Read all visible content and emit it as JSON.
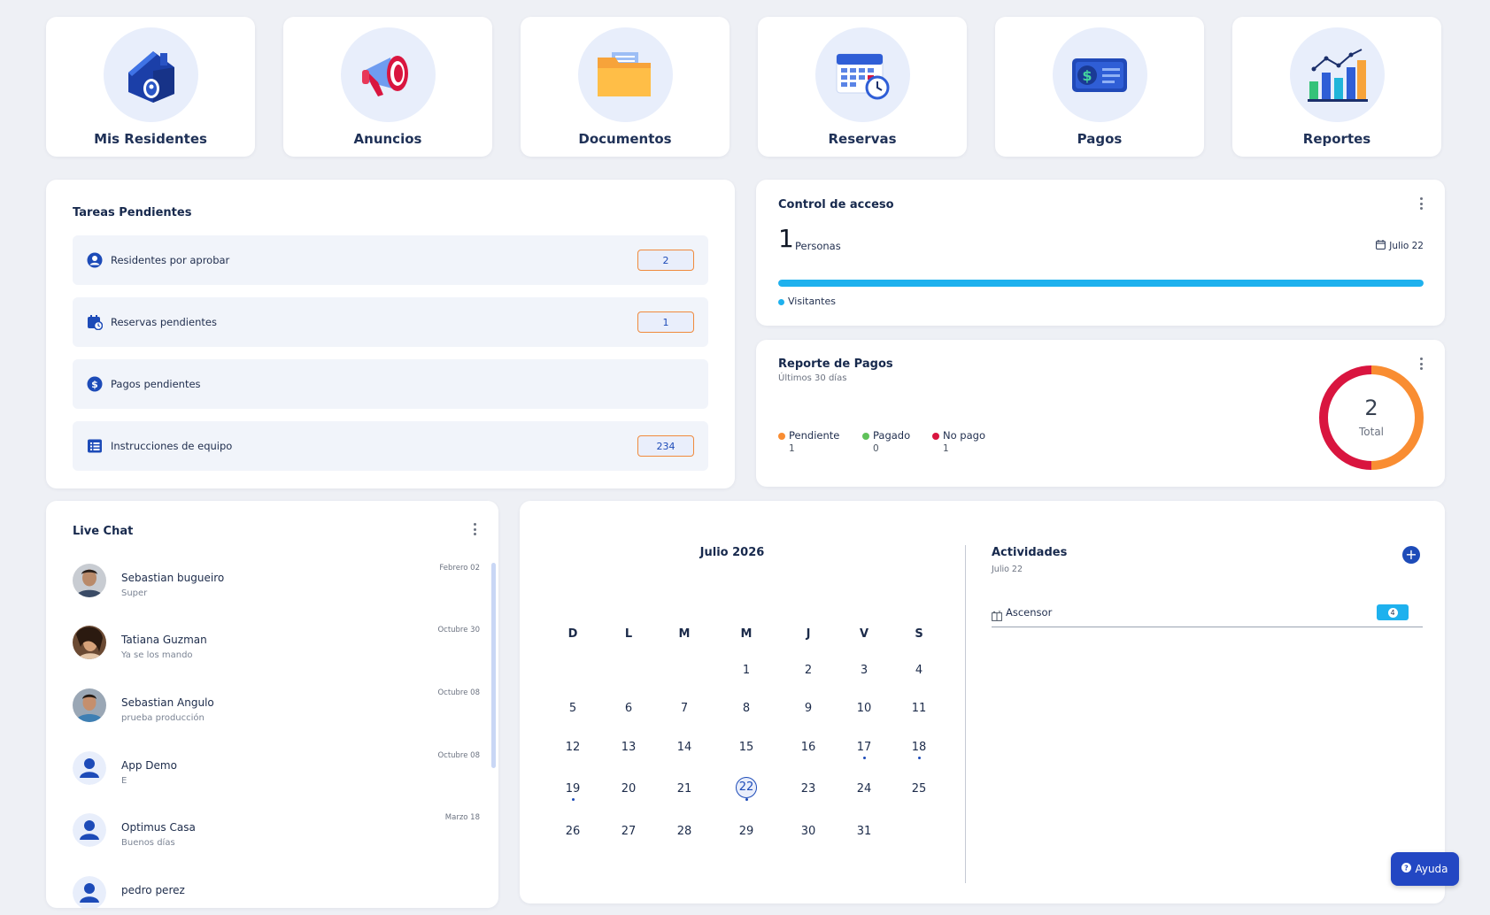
{
  "tiles": [
    {
      "label": "Mis Residentes",
      "icon": "house-icon"
    },
    {
      "label": "Anuncios",
      "icon": "megaphone-icon"
    },
    {
      "label": "Documentos",
      "icon": "folder-icon"
    },
    {
      "label": "Reservas",
      "icon": "calendar-clock-icon"
    },
    {
      "label": "Pagos",
      "icon": "money-icon"
    },
    {
      "label": "Reportes",
      "icon": "bar-chart-icon"
    }
  ],
  "tasks": {
    "title": "Tareas Pendientes",
    "items": [
      {
        "label": "Residentes por aprobar",
        "badge": "2",
        "icon": "user-circle-icon"
      },
      {
        "label": "Reservas pendientes",
        "badge": "1",
        "icon": "calendar-icon"
      },
      {
        "label": "Pagos pendientes",
        "badge": "",
        "icon": "dollar-circle-icon"
      },
      {
        "label": "Instrucciones de equipo",
        "badge": "234",
        "icon": "list-icon"
      }
    ]
  },
  "access": {
    "title": "Control de acceso",
    "count": "1",
    "count_label": "Personas",
    "date": "Julio 22",
    "legend": "Visitantes",
    "progress": 1.0,
    "color": "#1eb1ee"
  },
  "payments": {
    "title": "Reporte de Pagos",
    "subtitle": "Últimos 30 días",
    "legend": [
      {
        "label": "Pendiente",
        "value": "1",
        "color": "#f98d32"
      },
      {
        "label": "Pagado",
        "value": "0",
        "color": "#5fc25a"
      },
      {
        "label": "No pago",
        "value": "1",
        "color": "#d9153f"
      }
    ],
    "total": "2",
    "total_label": "Total"
  },
  "chat": {
    "title": "Live Chat",
    "items": [
      {
        "name": "Sebastian bugueiro",
        "msg": "Super",
        "date": "Febrero 02",
        "avatar": "photo"
      },
      {
        "name": "Tatiana Guzman",
        "msg": "Ya se los mando",
        "date": "Octubre 30",
        "avatar": "photo"
      },
      {
        "name": "Sebastian Angulo",
        "msg": "prueba producción",
        "date": "Octubre 08",
        "avatar": "photo"
      },
      {
        "name": "App Demo",
        "msg": "E",
        "date": "Octubre 08",
        "avatar": "default"
      },
      {
        "name": "Optimus Casa",
        "msg": "Buenos días",
        "date": "Marzo 18",
        "avatar": "default"
      },
      {
        "name": "pedro perez",
        "msg": "",
        "date": "",
        "avatar": "default"
      }
    ]
  },
  "calendar": {
    "title": "Julio 2026",
    "weekdays": [
      "D",
      "L",
      "M",
      "M",
      "J",
      "V",
      "S"
    ],
    "weeks": [
      [
        "",
        "",
        "",
        "1",
        "2",
        "3",
        "4"
      ],
      [
        "5",
        "6",
        "7",
        "8",
        "9",
        "10",
        "11"
      ],
      [
        "12",
        "13",
        "14",
        "15",
        "16",
        "17",
        "18"
      ],
      [
        "19",
        "20",
        "21",
        "22",
        "23",
        "24",
        "25"
      ],
      [
        "26",
        "27",
        "28",
        "29",
        "30",
        "31",
        ""
      ]
    ],
    "today": "22",
    "dots": [
      "17",
      "18",
      "19",
      "22"
    ]
  },
  "activities": {
    "title": "Actividades",
    "date": "Julio 22",
    "items": [
      {
        "label": "Ascensor",
        "badge": "4"
      }
    ]
  },
  "help": {
    "label": "Ayuda"
  }
}
